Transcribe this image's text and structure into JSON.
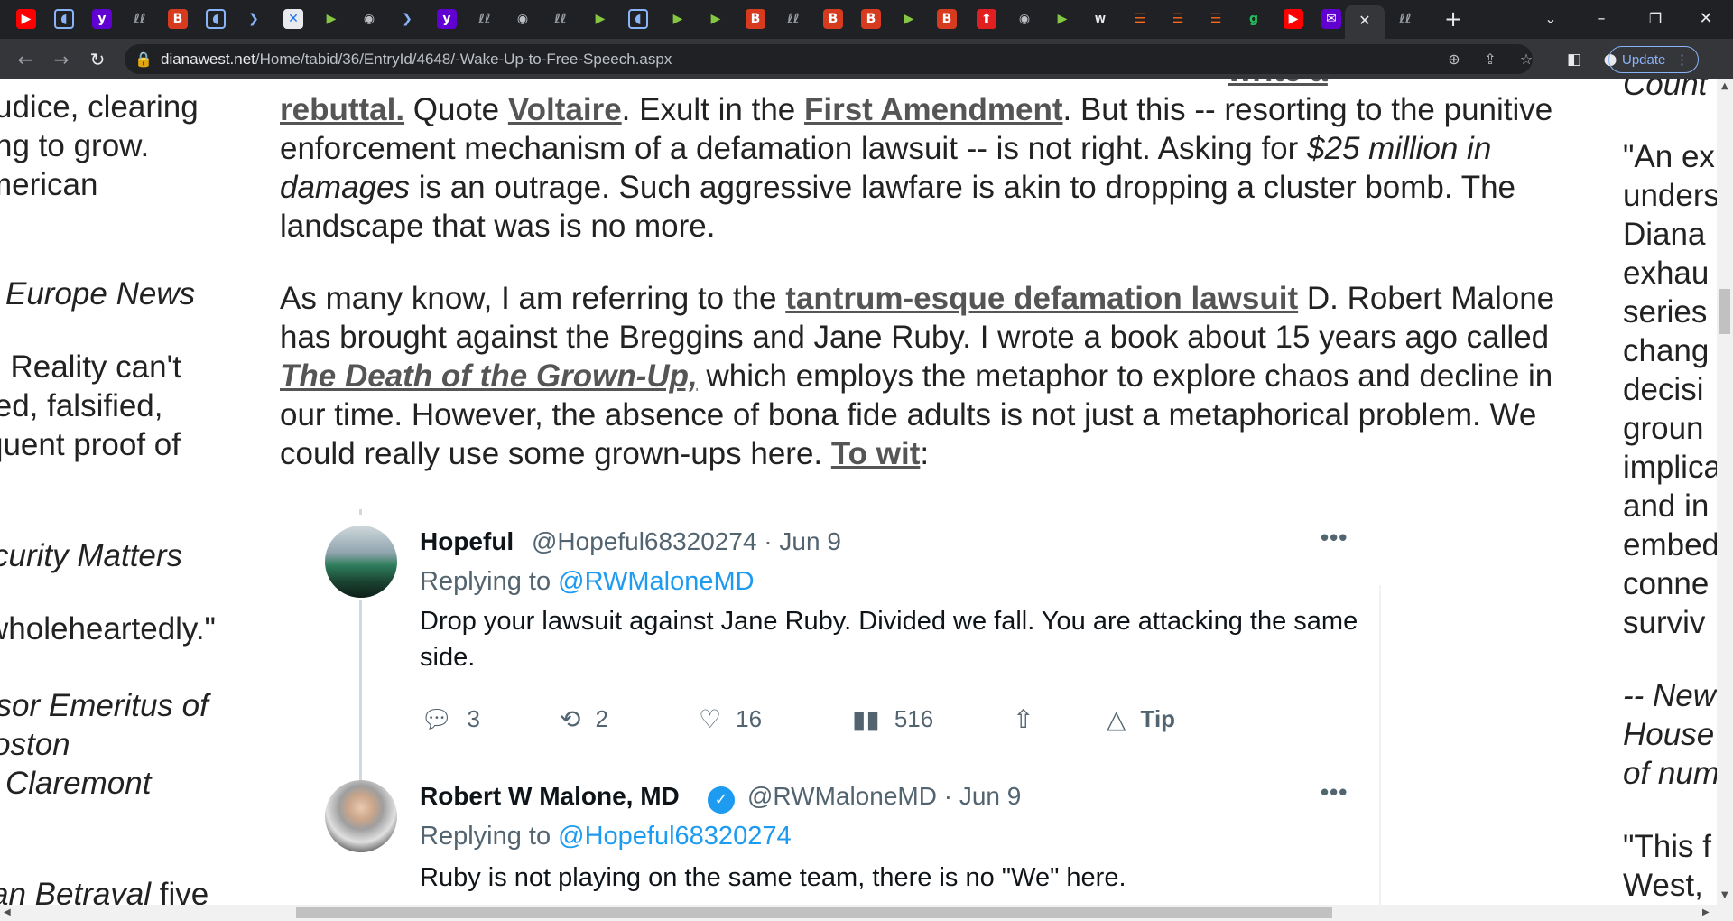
{
  "browser": {
    "url_domain": "dianawest.net",
    "url_path": "/Home/tabid/36/EntryId/4648/-Wake-Up-to-Free-Speech.aspx",
    "update_label": "Update"
  },
  "left_column": {
    "lines": [
      "udice, clearing",
      "ng to grow.",
      "merican"
    ],
    "europe_news": "Europe News",
    "lines2": [
      ": Reality can't",
      "ted, falsified,",
      "quent proof of"
    ],
    "security_matters": "curity Matters",
    "wholeheartedly": "wholeheartedly.\"",
    "emeritus_lines": [
      "ssor Emeritus of",
      "oston",
      "Claremont"
    ],
    "betrayal": "an Betrayal",
    "betrayal_suffix": " five"
  },
  "article": {
    "p1_link_write": "write a",
    "p1_link_rebuttal": "rebuttal.",
    "p1_text_quote": " Quote ",
    "p1_link_voltaire": "Voltaire",
    "p1_text_exult": ". Exult in the ",
    "p1_link_first_amendment": "First Amendment",
    "p1_text_rest": ". But this -- resorting to the punitive enforcement mechanism of a defamation lawsuit -- is not right. Asking for ",
    "p1_italic": "$25 million in damages",
    "p1_text_end": " is an outrage. Such aggressive lawfare is akin to dropping a cluster bomb. The landscape that was is no more.",
    "p2_text_start": "As many know, I am referring to the ",
    "p2_link_lawsuit": "tantrum-esque defamation lawsuit",
    "p2_text_mid": " D. Robert Malone has brought against the Breggins and Jane Ruby. I wrote a book about 15 years ago called ",
    "p2_link_book": "The Death of the Grown-Up,",
    "p2_text_rest": " which employs the metaphor to explore chaos and decline in our time. However, the absence of bona fide adults is not just a metaphorical problem. We could really use some grown-ups here. ",
    "p2_link_towit": "To wit",
    "p2_text_end": ":"
  },
  "tweets": [
    {
      "name": "Hopeful",
      "handle": "@Hopeful68320274 · Jun 9",
      "replying_prefix": "Replying to ",
      "replying_to": "@RWMaloneMD",
      "body": "Drop your lawsuit against Jane Ruby. Divided we fall. You are attacking the same side.",
      "replies": "3",
      "retweets": "2",
      "likes": "16",
      "views": "516",
      "tip_label": "Tip"
    },
    {
      "name": "Robert W Malone, MD",
      "handle": "@RWMaloneMD · Jun 9",
      "replying_prefix": "Replying to ",
      "replying_to": "@Hopeful68320274",
      "body": "Ruby is not playing on the same team, there is no \"We\" here."
    }
  ],
  "right_column": {
    "lines": [
      "Count",
      "\"An ex",
      "unders",
      "Diana",
      "exhau",
      "series",
      "chang",
      "decisi",
      "groun",
      "implica",
      "and in",
      "embed",
      "conne",
      "surviv"
    ],
    "new_line": "-- New",
    "house_line": "House",
    "of_num": "of num",
    "this_line": "\"This f",
    "west_line": "West,"
  }
}
